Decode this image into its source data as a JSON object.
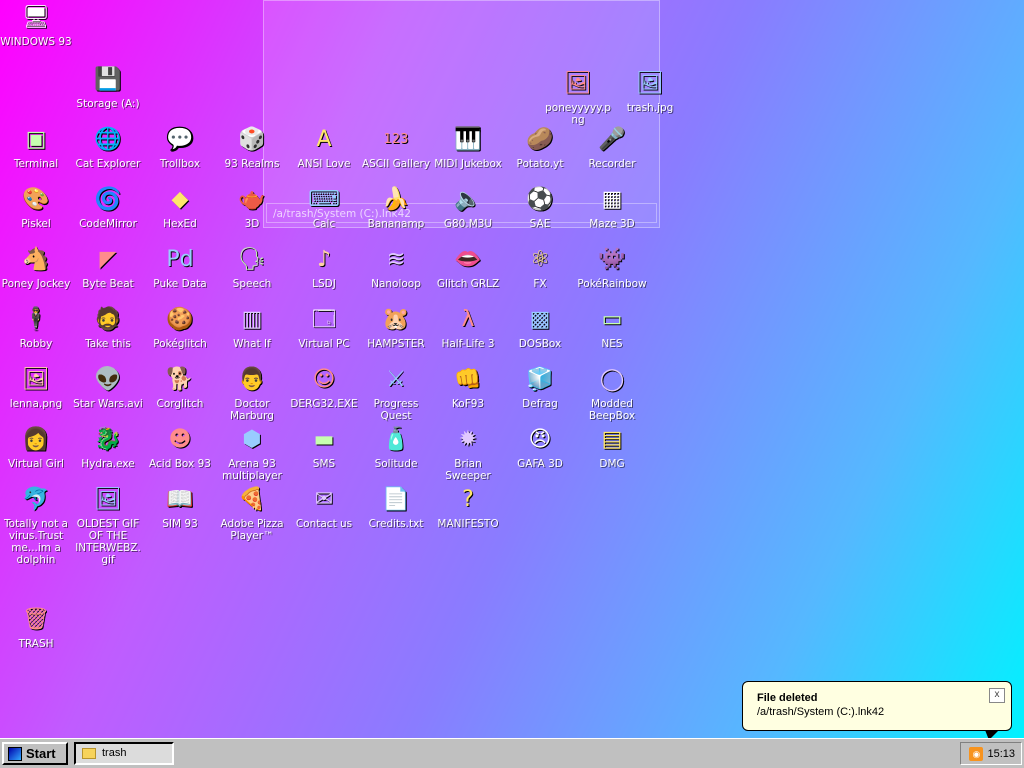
{
  "desktop": {
    "icons": [
      {
        "label": "WINDOWS 93",
        "glyph": "🖥"
      },
      {
        "label": "Storage (A:)",
        "glyph": "💾"
      },
      {
        "label": "poneyyyyy.png",
        "glyph": "🖼"
      },
      {
        "label": "trash.jpg",
        "glyph": "🖼"
      },
      {
        "label": "Terminal",
        "glyph": "▣"
      },
      {
        "label": "Cat Explorer",
        "glyph": "🌐"
      },
      {
        "label": "Trollbox",
        "glyph": "💬"
      },
      {
        "label": "93 Realms",
        "glyph": "🎲"
      },
      {
        "label": "ANSI Love",
        "glyph": "A"
      },
      {
        "label": "ASCII Gallery",
        "glyph": "123"
      },
      {
        "label": "MIDI Jukebox",
        "glyph": "🎹"
      },
      {
        "label": "Potato.yt",
        "glyph": "🥔"
      },
      {
        "label": "Recorder",
        "glyph": "🎤"
      },
      {
        "label": "Piskel",
        "glyph": "🎨"
      },
      {
        "label": "CodeMirror",
        "glyph": "🌀"
      },
      {
        "label": "HexEd",
        "glyph": "◆"
      },
      {
        "label": "3D",
        "glyph": "🫖"
      },
      {
        "label": "Calc",
        "glyph": "⌨"
      },
      {
        "label": "Bananamp",
        "glyph": "🍌"
      },
      {
        "label": "G80.M3U",
        "glyph": "🔈"
      },
      {
        "label": "SAE",
        "glyph": "⚽"
      },
      {
        "label": "Maze 3D",
        "glyph": "▦"
      },
      {
        "label": "Poney Jockey",
        "glyph": "🐴"
      },
      {
        "label": "Byte Beat",
        "glyph": "◤"
      },
      {
        "label": "Puke Data",
        "glyph": "Pd"
      },
      {
        "label": "Speech",
        "glyph": "🗣"
      },
      {
        "label": "LSDJ",
        "glyph": "♪"
      },
      {
        "label": "Nanoloop",
        "glyph": "≋"
      },
      {
        "label": "Glitch GRLZ",
        "glyph": "👄"
      },
      {
        "label": "FX",
        "glyph": "⚛"
      },
      {
        "label": "PokéRainbow",
        "glyph": "👾"
      },
      {
        "label": "Robby",
        "glyph": "🕴"
      },
      {
        "label": "Take this",
        "glyph": "🧔"
      },
      {
        "label": "Pokéglitch",
        "glyph": "🍪"
      },
      {
        "label": "What If",
        "glyph": "▥"
      },
      {
        "label": "Virtual PC",
        "glyph": "🗔"
      },
      {
        "label": "HAMPSTER",
        "glyph": "🐹"
      },
      {
        "label": "Half-Life 3",
        "glyph": "λ"
      },
      {
        "label": "DOSBox",
        "glyph": "▩"
      },
      {
        "label": "NES",
        "glyph": "▭"
      },
      {
        "label": "lenna.png",
        "glyph": "🖼"
      },
      {
        "label": "Star Wars.avi",
        "glyph": "👽"
      },
      {
        "label": "Corglitch",
        "glyph": "🐕"
      },
      {
        "label": "Doctor Marburg",
        "glyph": "👨"
      },
      {
        "label": "DERG32.EXE",
        "glyph": "☺"
      },
      {
        "label": "Progress Quest",
        "glyph": "⚔"
      },
      {
        "label": "KoF93",
        "glyph": "👊"
      },
      {
        "label": "Defrag",
        "glyph": "🧊"
      },
      {
        "label": "Modded BeepBox",
        "glyph": "◯"
      },
      {
        "label": "Virtual Girl",
        "glyph": "👩"
      },
      {
        "label": "Hydra.exe",
        "glyph": "🐉"
      },
      {
        "label": "Acid Box 93",
        "glyph": "☻"
      },
      {
        "label": "Arena 93 multiplayer",
        "glyph": "⬢"
      },
      {
        "label": "SMS",
        "glyph": "▬"
      },
      {
        "label": "Solitude",
        "glyph": "🧴"
      },
      {
        "label": "Brian Sweeper",
        "glyph": "✹"
      },
      {
        "label": "GAFA 3D",
        "glyph": "😠"
      },
      {
        "label": "DMG",
        "glyph": "▤"
      },
      {
        "label": "Totally not a virus.Trust me...im a dolphin",
        "glyph": "🐬"
      },
      {
        "label": "OLDEST GIF OF THE INTERWEBZ.gif",
        "glyph": "🖼"
      },
      {
        "label": "SIM 93",
        "glyph": "📖"
      },
      {
        "label": "Adobe Pizza Player™",
        "glyph": "🍕"
      },
      {
        "label": "Contact us",
        "glyph": "✉"
      },
      {
        "label": "Credits.txt",
        "glyph": "📄"
      },
      {
        "label": "MANIFESTO",
        "glyph": "?"
      },
      {
        "label": "TRASH",
        "glyph": "🗑"
      }
    ]
  },
  "drag_window": {
    "path": "/a/trash/System (C:).lnk42"
  },
  "notification": {
    "title": "File deleted",
    "message": "/a/trash/System (C:).lnk42",
    "close_label": "x"
  },
  "taskbar": {
    "start_label": "Start",
    "task_label": "trash",
    "clock": "15:13",
    "rss_glyph": "◉"
  }
}
